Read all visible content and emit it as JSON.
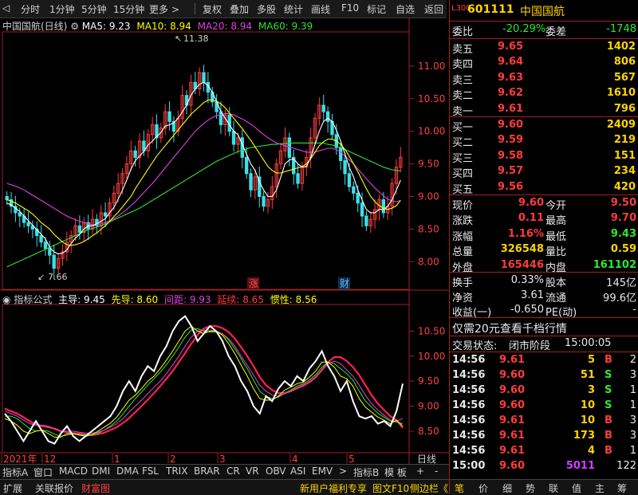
{
  "toolbar": {
    "items": [
      "分时",
      "1分钟",
      "5分钟",
      "15分钟",
      "更多 >",
      "复权",
      "叠加",
      "多股",
      "统计",
      "画线",
      "F10",
      "标记",
      "自选",
      "返回"
    ]
  },
  "chart_title": {
    "name": "中国国航(日线)",
    "ma5": "MA5: 9.23",
    "ma10": "MA10: 8.94",
    "ma20": "MA20: 8.94",
    "ma60": "MA60: 9.39"
  },
  "annotations": {
    "high": "11.38",
    "low": "7.66",
    "zhang": "涨",
    "cai": "财"
  },
  "indicator_title": {
    "name": "指标公式",
    "zhudao": "主导: 9.45",
    "xiandao": "先导: 8.60",
    "jianju": "间距: 9.93",
    "yanxu": "延续: 8.65",
    "guanxing": "惯性: 8.56"
  },
  "colors": {
    "up": "#ff3c3c",
    "down": "#3ae0e8",
    "ma5": "#ffffff",
    "ma10": "#ffff00",
    "ma20": "#e040e0",
    "ma60": "#30e030"
  },
  "chart_data": [
    {
      "type": "candlestick",
      "title": "中国国航(日线)",
      "ylim": [
        7.6,
        11.5
      ],
      "yticks": [
        "11.00",
        "10.50",
        "10.00",
        "9.50",
        "9.00",
        "8.50",
        "8.00"
      ],
      "ytick_values": [
        11.0,
        10.5,
        10.0,
        9.5,
        9.0,
        8.5,
        8.0
      ],
      "close": [
        8.95,
        8.85,
        8.75,
        8.7,
        8.6,
        8.55,
        8.5,
        8.4,
        8.3,
        8.2,
        8.1,
        7.9,
        8.05,
        8.15,
        8.3,
        8.4,
        8.55,
        8.45,
        8.6,
        8.5,
        8.65,
        8.55,
        8.75,
        8.7,
        8.9,
        9.05,
        9.2,
        9.35,
        9.5,
        9.7,
        9.6,
        9.85,
        9.7,
        9.95,
        10.1,
        9.9,
        10.05,
        10.3,
        10.15,
        10.0,
        10.2,
        10.55,
        10.4,
        10.75,
        10.65,
        10.9,
        10.75,
        10.6,
        10.45,
        10.3,
        10.1,
        10.25,
        10.0,
        9.8,
        9.9,
        9.6,
        9.35,
        9.1,
        9.3,
        9.0,
        8.85,
        8.95,
        9.15,
        9.5,
        9.7,
        9.9,
        9.6,
        9.35,
        9.2,
        9.45,
        9.6,
        9.9,
        10.2,
        10.4,
        10.3,
        10.15,
        9.95,
        9.75,
        9.55,
        9.35,
        9.15,
        9.05,
        8.9,
        8.7,
        8.55,
        8.65,
        8.8,
        8.95,
        8.75,
        8.85,
        9.2,
        9.45,
        9.6
      ],
      "ma5": [
        8.9,
        8.87,
        8.82,
        8.77,
        8.7,
        8.63,
        8.56,
        8.49,
        8.42,
        8.35,
        8.22,
        8.15,
        8.12,
        8.13,
        8.18,
        8.28,
        8.36,
        8.42,
        8.5,
        8.55,
        8.55,
        8.58,
        8.62,
        8.66,
        8.75,
        8.83,
        8.96,
        9.1,
        9.25,
        9.42,
        9.55,
        9.62,
        9.69,
        9.79,
        9.85,
        9.92,
        9.98,
        10.08,
        10.1,
        10.13,
        10.2,
        10.3,
        10.4,
        10.55,
        10.65,
        10.72,
        10.75,
        10.7,
        10.6,
        10.46,
        10.3,
        10.2,
        10.1,
        10.0,
        9.95,
        9.8,
        9.65,
        9.5,
        9.4,
        9.22,
        9.1,
        9.0,
        9.0,
        9.1,
        9.3,
        9.5,
        9.56,
        9.58,
        9.5,
        9.45,
        9.46,
        9.6,
        9.8,
        10.0,
        10.15,
        10.2,
        10.15,
        10.02,
        9.85,
        9.65,
        9.45,
        9.3,
        9.1,
        8.95,
        8.8,
        8.75,
        8.75,
        8.8,
        8.8,
        8.85,
        8.95,
        9.1,
        9.25
      ],
      "ma10": [
        8.95,
        8.93,
        8.9,
        8.86,
        8.82,
        8.78,
        8.73,
        8.67,
        8.6,
        8.55,
        8.5,
        8.42,
        8.36,
        8.3,
        8.26,
        8.25,
        8.26,
        8.28,
        8.31,
        8.35,
        8.4,
        8.44,
        8.5,
        8.55,
        8.62,
        8.69,
        8.76,
        8.84,
        8.92,
        9.0,
        9.12,
        9.22,
        9.32,
        9.42,
        9.52,
        9.62,
        9.7,
        9.78,
        9.86,
        9.94,
        10.02,
        10.1,
        10.18,
        10.26,
        10.32,
        10.38,
        10.44,
        10.48,
        10.48,
        10.46,
        10.42,
        10.36,
        10.28,
        10.2,
        10.12,
        10.04,
        9.95,
        9.86,
        9.76,
        9.66,
        9.56,
        9.46,
        9.4,
        9.36,
        9.36,
        9.38,
        9.4,
        9.42,
        9.44,
        9.46,
        9.5,
        9.58,
        9.68,
        9.78,
        9.84,
        9.88,
        9.88,
        9.85,
        9.8,
        9.72,
        9.62,
        9.5,
        9.38,
        9.25,
        9.12,
        9.0,
        8.92,
        8.86,
        8.82,
        8.8,
        8.82,
        8.86,
        8.94
      ],
      "ma20": [
        9.2,
        9.18,
        9.16,
        9.13,
        9.1,
        9.06,
        9.02,
        8.98,
        8.94,
        8.9,
        8.86,
        8.82,
        8.78,
        8.74,
        8.7,
        8.67,
        8.64,
        8.62,
        8.6,
        8.58,
        8.57,
        8.57,
        8.58,
        8.6,
        8.63,
        8.66,
        8.7,
        8.75,
        8.8,
        8.86,
        8.92,
        8.99,
        9.06,
        9.13,
        9.2,
        9.28,
        9.36,
        9.44,
        9.52,
        9.6,
        9.68,
        9.76,
        9.84,
        9.92,
        10.0,
        10.06,
        10.12,
        10.17,
        10.21,
        10.24,
        10.26,
        10.27,
        10.27,
        10.25,
        10.22,
        10.19,
        10.15,
        10.11,
        10.06,
        10.0,
        9.95,
        9.9,
        9.86,
        9.82,
        9.8,
        9.78,
        9.76,
        9.74,
        9.72,
        9.7,
        9.68,
        9.68,
        9.68,
        9.7,
        9.72,
        9.74,
        9.74,
        9.72,
        9.68,
        9.62,
        9.56,
        9.5,
        9.42,
        9.35,
        9.27,
        9.2,
        9.13,
        9.07,
        9.01,
        8.96,
        8.93,
        8.92,
        8.94
      ],
      "ma60": [
        7.92,
        7.95,
        7.98,
        8.01,
        8.04,
        8.07,
        8.1,
        8.13,
        8.16,
        8.19,
        8.22,
        8.25,
        8.28,
        8.31,
        8.34,
        8.37,
        8.4,
        8.43,
        8.46,
        8.49,
        8.51,
        8.53,
        8.55,
        8.58,
        8.61,
        8.64,
        8.67,
        8.7,
        8.73,
        8.76,
        8.79,
        8.82,
        8.86,
        8.9,
        8.94,
        8.98,
        9.02,
        9.06,
        9.1,
        9.14,
        9.18,
        9.22,
        9.26,
        9.3,
        9.34,
        9.38,
        9.42,
        9.46,
        9.5,
        9.54,
        9.57,
        9.6,
        9.63,
        9.66,
        9.69,
        9.71,
        9.73,
        9.75,
        9.76,
        9.77,
        9.78,
        9.79,
        9.8,
        9.8,
        9.81,
        9.81,
        9.82,
        9.82,
        9.82,
        9.82,
        9.82,
        9.82,
        9.82,
        9.82,
        9.82,
        9.8,
        9.79,
        9.77,
        9.75,
        9.72,
        9.69,
        9.66,
        9.63,
        9.6,
        9.57,
        9.54,
        9.51,
        9.48,
        9.45,
        9.43,
        9.41,
        9.4,
        9.39
      ]
    },
    {
      "type": "line",
      "title": "指标公式",
      "ylim": [
        8.1,
        11.0
      ],
      "yticks": [
        "10.50",
        "10.00",
        "9.50",
        "9.00",
        "8.50"
      ],
      "ytick_values": [
        10.5,
        10.0,
        9.5,
        9.0,
        8.5
      ],
      "series": [
        {
          "name": "主导",
          "color": "#ffffff",
          "values": [
            8.85,
            8.7,
            8.5,
            8.3,
            8.5,
            8.7,
            8.5,
            8.3,
            8.25,
            8.45,
            8.6,
            8.4,
            8.3,
            8.4,
            8.5,
            8.6,
            8.7,
            8.8,
            9.0,
            9.3,
            9.5,
            9.3,
            9.6,
            9.8,
            9.7,
            10.0,
            10.2,
            10.5,
            10.7,
            10.8,
            10.6,
            10.3,
            10.45,
            10.6,
            10.5,
            10.3,
            10.0,
            9.8,
            9.5,
            9.3,
            9.0,
            8.85,
            9.2,
            9.1,
            9.35,
            9.5,
            9.4,
            9.6,
            9.5,
            9.75,
            9.9,
            10.1,
            9.8,
            9.6,
            9.3,
            9.5,
            9.1,
            8.8,
            8.75,
            8.8,
            8.65,
            8.7,
            8.6,
            8.9,
            9.45
          ]
        },
        {
          "name": "先导",
          "color": "#ffff00",
          "values": [
            8.75,
            8.7,
            8.62,
            8.5,
            8.45,
            8.5,
            8.52,
            8.45,
            8.38,
            8.38,
            8.45,
            8.45,
            8.42,
            8.4,
            8.43,
            8.5,
            8.58,
            8.66,
            8.78,
            8.95,
            9.12,
            9.22,
            9.35,
            9.5,
            9.6,
            9.75,
            9.92,
            10.1,
            10.3,
            10.5,
            10.6,
            10.5,
            10.45,
            10.5,
            10.5,
            10.42,
            10.25,
            10.05,
            9.82,
            9.6,
            9.35,
            9.15,
            9.12,
            9.12,
            9.2,
            9.32,
            9.38,
            9.45,
            9.48,
            9.58,
            9.7,
            9.88,
            9.88,
            9.78,
            9.6,
            9.55,
            9.4,
            9.15,
            8.98,
            8.88,
            8.78,
            8.72,
            8.65,
            8.72,
            8.6
          ]
        },
        {
          "name": "间距",
          "color": "#e040e0",
          "values": [
            8.9,
            8.85,
            8.8,
            8.72,
            8.65,
            8.62,
            8.62,
            8.6,
            8.55,
            8.5,
            8.5,
            8.5,
            8.48,
            8.46,
            8.46,
            8.48,
            8.52,
            8.58,
            8.65,
            8.75,
            8.88,
            9.0,
            9.12,
            9.25,
            9.38,
            9.5,
            9.65,
            9.82,
            10.0,
            10.2,
            10.38,
            10.5,
            10.52,
            10.52,
            10.5,
            10.45,
            10.35,
            10.2,
            10.0,
            9.82,
            9.62,
            9.42,
            9.3,
            9.22,
            9.2,
            9.25,
            9.3,
            9.35,
            9.4,
            9.47,
            9.57,
            9.72,
            9.85,
            9.9,
            9.85,
            9.72,
            9.6,
            9.42,
            9.22,
            9.05,
            8.92,
            8.82,
            8.72,
            8.7,
            8.75
          ]
        },
        {
          "name": "延续",
          "color": "#2ee82e",
          "values": [
            8.8,
            8.8,
            8.75,
            8.65,
            8.55,
            8.5,
            8.52,
            8.5,
            8.44,
            8.4,
            8.42,
            8.45,
            8.43,
            8.42,
            8.42,
            8.46,
            8.52,
            8.6,
            8.7,
            8.84,
            9.0,
            9.15,
            9.28,
            9.42,
            9.55,
            9.68,
            9.83,
            10.0,
            10.18,
            10.38,
            10.52,
            10.55,
            10.5,
            10.48,
            10.48,
            10.45,
            10.32,
            10.15,
            9.95,
            9.75,
            9.52,
            9.3,
            9.2,
            9.15,
            9.18,
            9.25,
            9.32,
            9.4,
            9.45,
            9.52,
            9.63,
            9.78,
            9.88,
            9.85,
            9.75,
            9.65,
            9.52,
            9.3,
            9.1,
            8.98,
            8.86,
            8.78,
            8.7,
            8.68,
            8.65
          ]
        },
        {
          "name": "惯性",
          "color": "#ff2050",
          "values": [
            8.95,
            8.9,
            8.85,
            8.78,
            8.7,
            8.63,
            8.6,
            8.58,
            8.55,
            8.5,
            8.48,
            8.46,
            8.45,
            8.43,
            8.42,
            8.44,
            8.47,
            8.52,
            8.58,
            8.66,
            8.76,
            8.88,
            9.0,
            9.13,
            9.26,
            9.4,
            9.55,
            9.7,
            9.88,
            10.06,
            10.25,
            10.42,
            10.55,
            10.6,
            10.6,
            10.56,
            10.48,
            10.35,
            10.18,
            10.0,
            9.8,
            9.58,
            9.42,
            9.32,
            9.26,
            9.26,
            9.3,
            9.36,
            9.42,
            9.48,
            9.58,
            9.72,
            9.88,
            9.98,
            9.98,
            9.9,
            9.78,
            9.62,
            9.42,
            9.22,
            9.05,
            8.92,
            8.8,
            8.72,
            8.56
          ]
        }
      ]
    }
  ],
  "xaxis": {
    "labels": [
      "2021年",
      "12",
      "1",
      "2",
      "3",
      "4",
      "5"
    ],
    "mode": "日线"
  },
  "bottom_tabs": [
    "指标A",
    "窗口",
    "MACD",
    "DMI",
    "DMA",
    "FSL",
    "TRIX",
    "BRAR",
    "CR",
    "VR",
    "OBV",
    "ASI",
    "EMV",
    ">",
    "指标B",
    "模 板",
    "+",
    "-"
  ],
  "status_bar": {
    "left": [
      "扩展",
      "关联报价",
      "财富图"
    ],
    "right": [
      "新用户福利专享",
      "图文F10",
      "侧边栏《"
    ]
  },
  "quote": {
    "code": "601111",
    "name": "中国国航",
    "badge": "L300",
    "weibi_label": "委比",
    "weibi": "-20.29%",
    "weicha_label": "委差",
    "weicha": "-1748",
    "sell": [
      {
        "label": "卖五",
        "price": "9.65",
        "vol": "1402"
      },
      {
        "label": "卖四",
        "price": "9.64",
        "vol": "806"
      },
      {
        "label": "卖三",
        "price": "9.63",
        "vol": "567"
      },
      {
        "label": "卖二",
        "price": "9.62",
        "vol": "1610"
      },
      {
        "label": "卖一",
        "price": "9.61",
        "vol": "796"
      }
    ],
    "buy": [
      {
        "label": "买一",
        "price": "9.60",
        "vol": "2409"
      },
      {
        "label": "买二",
        "price": "9.59",
        "vol": "219"
      },
      {
        "label": "买三",
        "price": "9.58",
        "vol": "151"
      },
      {
        "label": "买四",
        "price": "9.57",
        "vol": "234"
      },
      {
        "label": "买五",
        "price": "9.56",
        "vol": "420"
      }
    ],
    "stats": [
      {
        "l1": "现价",
        "v1": "9.60",
        "c1": "red",
        "l2": "今开",
        "v2": "9.50",
        "c2": "red"
      },
      {
        "l1": "涨跌",
        "v1": "0.11",
        "c1": "red",
        "l2": "最高",
        "v2": "9.70",
        "c2": "red"
      },
      {
        "l1": "涨幅",
        "v1": "1.16%",
        "c1": "red",
        "l2": "最低",
        "v2": "9.43",
        "c2": "green"
      },
      {
        "l1": "总量",
        "v1": "326548",
        "c1": "yellow",
        "l2": "量比",
        "v2": "0.59",
        "c2": "yellow"
      },
      {
        "l1": "外盘",
        "v1": "165446",
        "c1": "red",
        "l2": "内盘",
        "v2": "161102",
        "c2": "green"
      }
    ],
    "stats2": [
      {
        "l1": "换手",
        "v1": "0.33%",
        "l2": "股本",
        "v2": "145亿"
      },
      {
        "l1": "净资",
        "v1": "3.61",
        "l2": "流通",
        "v2": "99.6亿"
      },
      {
        "l1": "收益(一)",
        "v1": "-0.650",
        "l2": "PE(动)",
        "v2": "-"
      }
    ],
    "promo": "仅需20元查看千档行情",
    "trade_status_label": "交易状态:",
    "trade_status": "闭市阶段",
    "trade_time": "15:00:05",
    "ticks": [
      {
        "t": "14:56",
        "p": "9.61",
        "v": "5",
        "s": "B",
        "n": "2",
        "pc": "red",
        "vc": "yellow",
        "sc": "red"
      },
      {
        "t": "14:56",
        "p": "9.60",
        "v": "51",
        "s": "S",
        "n": "3",
        "pc": "red",
        "vc": "yellow",
        "sc": "green"
      },
      {
        "t": "14:56",
        "p": "9.60",
        "v": "3",
        "s": "S",
        "n": "1",
        "pc": "red",
        "vc": "yellow",
        "sc": "green"
      },
      {
        "t": "14:56",
        "p": "9.60",
        "v": "10",
        "s": "S",
        "n": "1",
        "pc": "red",
        "vc": "yellow",
        "sc": "green"
      },
      {
        "t": "14:56",
        "p": "9.61",
        "v": "10",
        "s": "B",
        "n": "3",
        "pc": "red",
        "vc": "yellow",
        "sc": "red"
      },
      {
        "t": "14:56",
        "p": "9.61",
        "v": "173",
        "s": "B",
        "n": "3",
        "pc": "red",
        "vc": "yellow",
        "sc": "red"
      },
      {
        "t": "14:56",
        "p": "9.61",
        "v": "4",
        "s": "B",
        "n": "1",
        "pc": "red",
        "vc": "yellow",
        "sc": "red"
      },
      {
        "t": "15:00",
        "p": "9.60",
        "v": "5011",
        "s": "",
        "n": "122",
        "pc": "red",
        "vc": "magenta",
        "sc": "red"
      }
    ],
    "nav": [
      "笔",
      "价",
      "细",
      "势",
      "联",
      "值",
      "主",
      "筹"
    ]
  }
}
